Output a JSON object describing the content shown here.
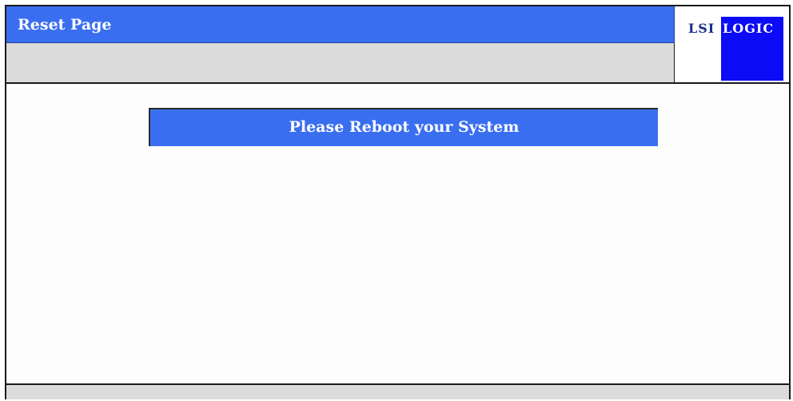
{
  "header": {
    "title": "Reset Page"
  },
  "logo": {
    "part1": "LSI",
    "part2": "LOGIC"
  },
  "main": {
    "message": "Please Reboot your System"
  },
  "colors": {
    "accent_blue": "#3a6ef0",
    "logo_blue": "#0b0bf5",
    "panel_gray": "#dcdbdc"
  }
}
